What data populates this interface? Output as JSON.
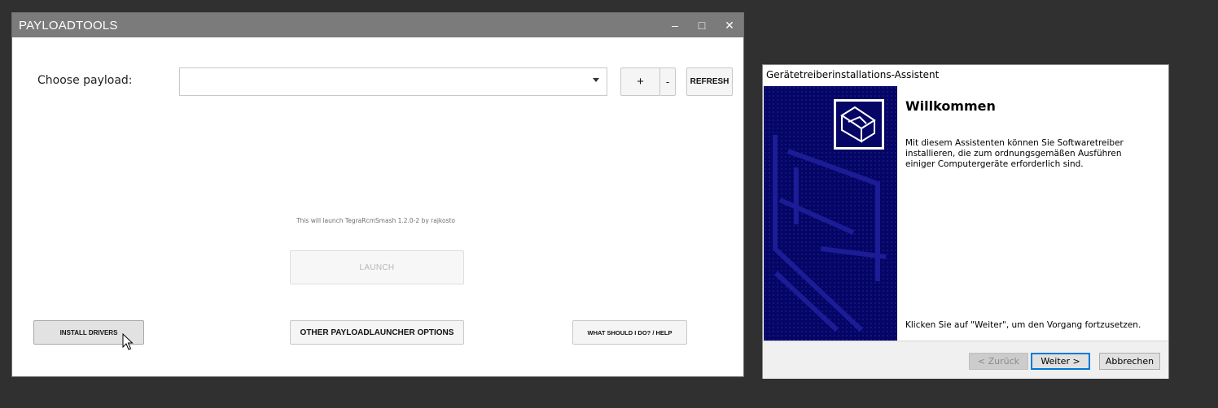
{
  "payloadtools": {
    "title": "PAYLOADTOOLS",
    "controls": {
      "minimize": "–",
      "maximize": "□",
      "close": "✕"
    },
    "choose_label": "Choose payload:",
    "payload_select_value": "",
    "plus_label": "+",
    "minus_label": "-",
    "refresh_label": "REFRESH",
    "launch_info": "This will launch TegraRcmSmash 1.2.0-2 by rajkosto",
    "launch_label": "LAUNCH",
    "install_drivers_label": "INSTALL DRIVERS",
    "other_options_label": "OTHER PAYLOADLAUNCHER OPTIONS",
    "help_label": "WHAT SHOULD I DO? / HELP"
  },
  "wizard": {
    "title": "Gerätetreiberinstallations-Assistent",
    "heading": "Willkommen",
    "description": "Mit diesem Assistenten können Sie Softwaretreiber installieren, die zum ordnungsgemäßen Ausführen einiger Computergeräte erforderlich sind.",
    "continue_text": "Klicken Sie auf \"Weiter\", um den Vorgang fortzusetzen.",
    "back_label": "< Zurück",
    "next_label": "Weiter >",
    "cancel_label": "Abbrechen"
  },
  "icons": [
    "minimize-icon",
    "maximize-icon",
    "close-icon",
    "dropdown-arrow-icon",
    "mouse-cursor-icon",
    "hardware-device-icon"
  ],
  "colors": {
    "desktop": "#303030",
    "titlebar": "#7b7b7b",
    "wizard_banner": "#050566",
    "focus": "#0078d7"
  }
}
